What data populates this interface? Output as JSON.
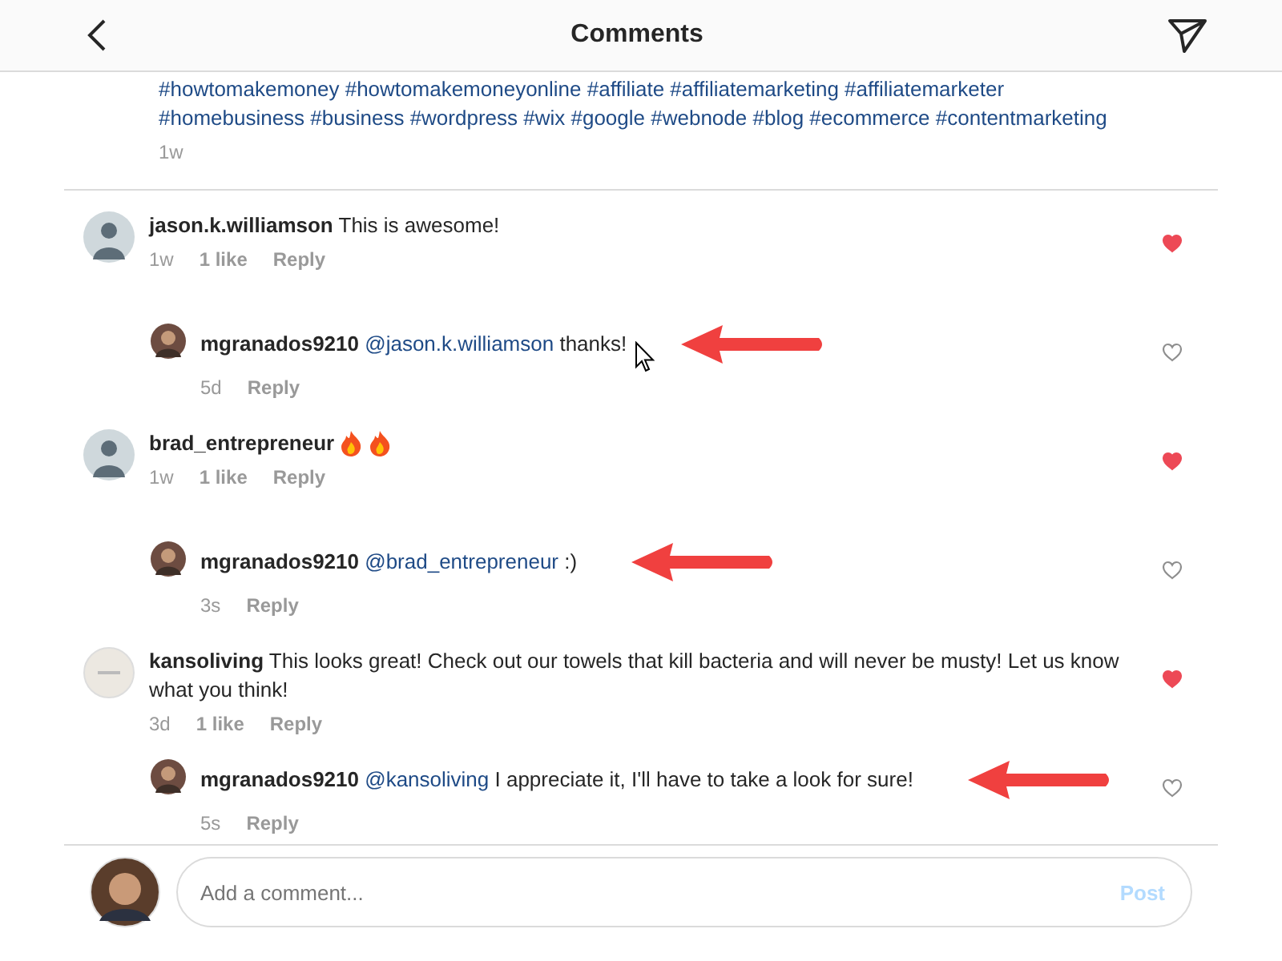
{
  "header": {
    "title": "Comments"
  },
  "caption": {
    "lines": [
      "#howtomakemoney #howtomakemoneyonline #affiliate #affiliatemarketing #affiliatemarketer",
      "#homebusiness #business #wordpress #wix #google #webnode #blog #ecommerce #contentmarketing"
    ],
    "time": "1w"
  },
  "comments": [
    {
      "kind": "photo",
      "user": "jason.k.williamson",
      "text": "This is awesome!",
      "time": "1w",
      "likes": "1 like",
      "reply_label": "Reply",
      "liked": true,
      "replies": [
        {
          "user": "mgranados9210",
          "mention": "@jason.k.williamson",
          "text": "thanks!",
          "time": "5d",
          "reply_label": "Reply",
          "liked": false,
          "annotated": true
        }
      ]
    },
    {
      "kind": "photo",
      "user": "brad_entrepreneur",
      "icons": [
        {
          "kind": "fire"
        },
        {
          "kind": "fire"
        }
      ],
      "time": "1w",
      "likes": "1 like",
      "reply_label": "Reply",
      "liked": true,
      "replies": [
        {
          "user": "mgranados9210",
          "mention": "@brad_entrepreneur",
          "text": ":)",
          "time": "3s",
          "reply_label": "Reply",
          "liked": false,
          "annotated": true
        }
      ]
    },
    {
      "kind": "logo",
      "user": "kansoliving",
      "text": "This looks great! Check out our towels that kill bacteria and will never be musty! Let us know what you think!",
      "time": "3d",
      "likes": "1 like",
      "reply_label": "Reply",
      "liked": true,
      "replies": [
        {
          "user": "mgranados9210",
          "mention": "@kansoliving",
          "text": "I appreciate it, I'll have to take a look for sure!",
          "time": "5s",
          "reply_label": "Reply",
          "liked": false,
          "annotated": true
        }
      ]
    }
  ],
  "composer": {
    "placeholder": "Add a comment...",
    "post_label": "Post"
  }
}
